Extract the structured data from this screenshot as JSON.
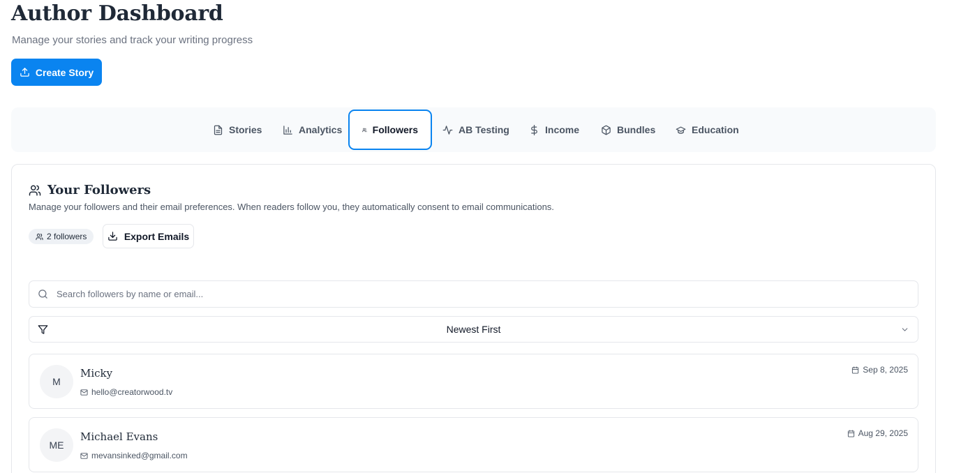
{
  "header": {
    "title": "Author Dashboard",
    "subtitle": "Manage your stories and track your writing progress",
    "create_label": "Create Story"
  },
  "tabs": [
    {
      "label": "Stories",
      "icon": "document-icon"
    },
    {
      "label": "Analytics",
      "icon": "bar-chart-icon"
    },
    {
      "label": "Followers",
      "icon": "users-icon",
      "active": true
    },
    {
      "label": "AB Testing",
      "icon": "activity-icon"
    },
    {
      "label": "Income",
      "icon": "dollar-icon"
    },
    {
      "label": "Bundles",
      "icon": "package-icon"
    },
    {
      "label": "Education",
      "icon": "graduation-cap-icon"
    }
  ],
  "followers_panel": {
    "title": "Your Followers",
    "description": "Manage your followers and their email preferences. When readers follow you, they automatically consent to email communications.",
    "count_label": "2 followers",
    "export_label": "Export Emails",
    "search_placeholder": "Search followers by name or email...",
    "sort_value": "Newest First"
  },
  "followers": [
    {
      "initials": "M",
      "name": "Micky",
      "email": "hello@creatorwood.tv",
      "date": "Sep 8, 2025"
    },
    {
      "initials": "ME",
      "name": "Michael Evans",
      "email": "mevansinked@gmail.com",
      "date": "Aug 29, 2025"
    }
  ],
  "colors": {
    "accent": "#0a84f0",
    "border": "#e5e7eb",
    "tabbar_bg": "#f8fafc"
  }
}
